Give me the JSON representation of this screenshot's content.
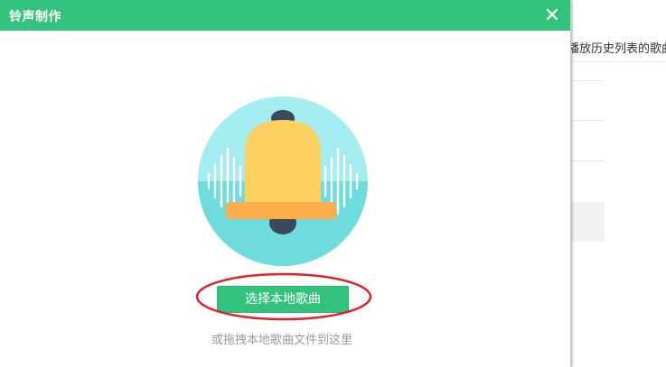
{
  "dialog": {
    "title": "铃声制作",
    "close_icon": "close-icon",
    "accent_color": "#31c27c"
  },
  "main": {
    "illustration_icon": "bell-icon",
    "select_button_label": "选择本地歌曲",
    "drag_hint": "或拖拽本地歌曲文件到这里",
    "annotation_color": "#d9262c"
  },
  "background_window": {
    "header_text": "播放历史列表的歌曲"
  }
}
